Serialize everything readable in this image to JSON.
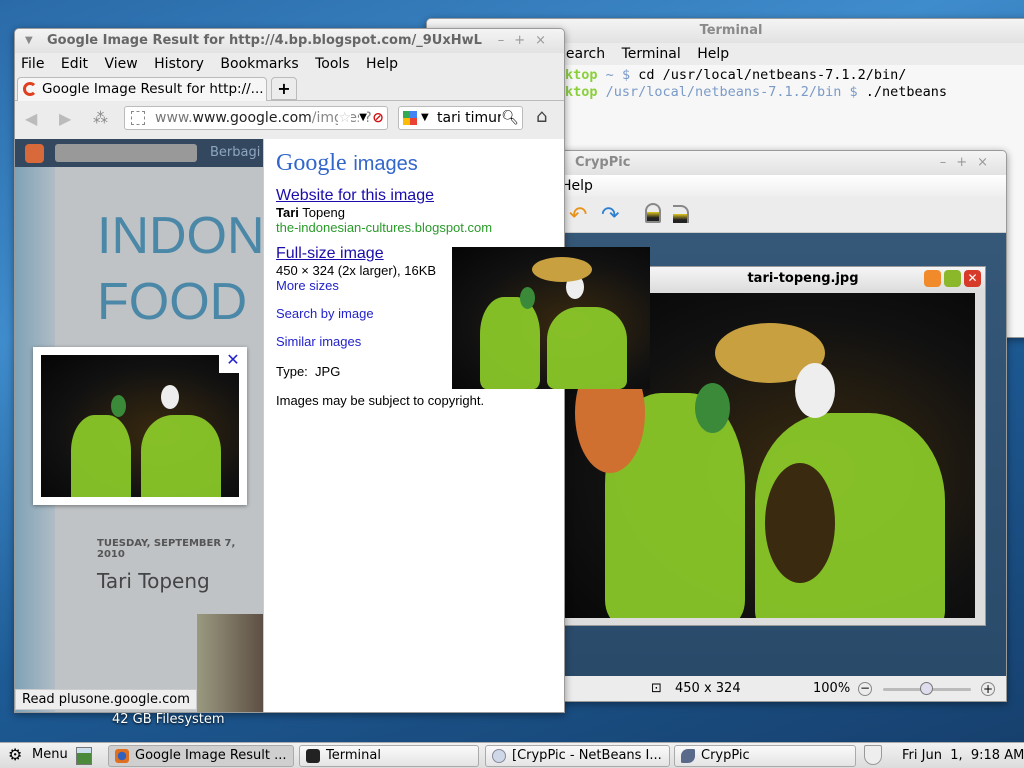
{
  "desktop": {
    "filesystem_label": "42 GB Filesystem"
  },
  "terminal": {
    "title": "Terminal",
    "menu": [
      "Search",
      "Terminal",
      "Help"
    ],
    "lines": [
      {
        "prompt": "ktop",
        "path": "~",
        "cmd": "cd /usr/local/netbeans-7.1.2/bin/"
      },
      {
        "prompt": "ktop",
        "path": "/usr/local/netbeans-7.1.2/bin",
        "cmd": "./netbeans"
      }
    ]
  },
  "cryppic": {
    "title": "CrypPic",
    "menu": [
      "Help"
    ],
    "image_title": "tari-topeng.jpg",
    "dimensions": "450 x 324",
    "zoom": "100%",
    "zoom_slider_fraction": 0.5
  },
  "browser": {
    "title": "Google Image Result for http://4.bp.blogspot.com/_9UxHwL",
    "menu": [
      "File",
      "Edit",
      "View",
      "History",
      "Bookmarks",
      "Tools",
      "Help"
    ],
    "tab_label": "Google Image Result for http://...",
    "new_tab": "+",
    "url_domain": "www.google.com",
    "url_path": "/imgres?c",
    "search_value": "tari timur",
    "blog": {
      "share": "Berbagi",
      "title1": "INDON",
      "title2": "FOOD",
      "date": "TUESDAY, SEPTEMBER 7, 2010",
      "post_title": "Tari Topeng",
      "close": "✕",
      "status": "Read plusone.google.com"
    },
    "google": {
      "logo": "Google",
      "logo_suffix": "images",
      "website_link": "Website for this image",
      "site_title_bold": "Tari",
      "site_title_rest": "Topeng",
      "site_url": "the-indonesian-cultures.blogspot.com",
      "fullsize_link": "Full-size image",
      "fullsize_info": "450 × 324 (2x larger), 16KB",
      "more_sizes": "More sizes",
      "search_by_image": "Search by image",
      "similar_images": "Similar images",
      "type_label": "Type:",
      "type_value": "JPG",
      "copyright": "Images may be subject to copyright."
    }
  },
  "taskbar": {
    "menu": "Menu",
    "items": [
      "Google Image Result ...",
      "Terminal",
      "[CrypPic - NetBeans I...",
      "CrypPic"
    ],
    "clock": "Fri Jun  1,  9:18 AM"
  }
}
